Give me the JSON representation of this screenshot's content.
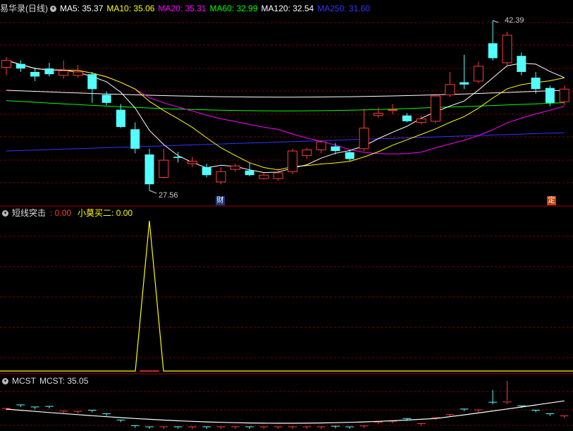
{
  "main_panel": {
    "title": "易华录(日线)",
    "ma": [
      {
        "label": "MA5: 35.37",
        "color": "#ffffff"
      },
      {
        "label": "MA10: 35.06",
        "color": "#ffff00"
      },
      {
        "label": "MA20: 35.31",
        "color": "#ff00ff"
      },
      {
        "label": "MA60: 32.99",
        "color": "#00ff00"
      },
      {
        "label": "MA120: 32.54",
        "color": "#ffffff"
      },
      {
        "label": "MA250: 31.60",
        "color": "#3333ff"
      }
    ],
    "high_label": "42.39",
    "low_label": "27.56",
    "tag_cai": "财",
    "tag_ding": "定"
  },
  "indicator_panel": {
    "name": "短线突击",
    "value1": ": 0.00",
    "name2": "小莫买二",
    "value2": ": 0.00"
  },
  "mcst_panel": {
    "name": "MCST",
    "value": "MCST: 35.05"
  },
  "colors": {
    "up": "#ff3b3b",
    "down": "#54ffff",
    "grid": "#7a0000",
    "divider": "#a00000"
  },
  "chart_data": {
    "type": "candlestick",
    "candles": [
      {
        "o": 38.3,
        "c": 38.9,
        "h": 39.2,
        "l": 37.6
      },
      {
        "o": 38.6,
        "c": 38.2,
        "h": 38.9,
        "l": 37.9
      },
      {
        "o": 37.9,
        "c": 37.5,
        "h": 38.3,
        "l": 37.1
      },
      {
        "o": 38.2,
        "c": 37.7,
        "h": 38.7,
        "l": 37.5
      },
      {
        "o": 37.6,
        "c": 38.0,
        "h": 38.9,
        "l": 37.3
      },
      {
        "o": 37.6,
        "c": 37.9,
        "h": 38.5,
        "l": 37.4
      },
      {
        "o": 37.7,
        "c": 36.4,
        "h": 37.9,
        "l": 35.2
      },
      {
        "o": 35.9,
        "c": 35.2,
        "h": 36.2,
        "l": 35.0
      },
      {
        "o": 34.6,
        "c": 33.1,
        "h": 35.1,
        "l": 33.0
      },
      {
        "o": 32.9,
        "c": 31.2,
        "h": 33.5,
        "l": 30.8
      },
      {
        "o": 30.7,
        "c": 28.1,
        "h": 31.2,
        "l": 27.56
      },
      {
        "o": 28.7,
        "c": 30.2,
        "h": 31.2,
        "l": 28.6
      },
      {
        "o": 30.5,
        "c": 30.4,
        "h": 30.9,
        "l": 30.0
      },
      {
        "o": 29.9,
        "c": 30.1,
        "h": 30.5,
        "l": 29.6
      },
      {
        "o": 29.6,
        "c": 28.9,
        "h": 29.9,
        "l": 28.7
      },
      {
        "o": 28.3,
        "c": 29.2,
        "h": 29.6,
        "l": 28.1
      },
      {
        "o": 29.4,
        "c": 29.7,
        "h": 29.9,
        "l": 29.2
      },
      {
        "o": 29.3,
        "c": 28.9,
        "h": 30.0,
        "l": 28.8
      },
      {
        "o": 28.6,
        "c": 28.9,
        "h": 29.1,
        "l": 28.5
      },
      {
        "o": 28.6,
        "c": 29.1,
        "h": 29.5,
        "l": 28.4
      },
      {
        "o": 29.2,
        "c": 31.0,
        "h": 31.2,
        "l": 29.0
      },
      {
        "o": 30.6,
        "c": 31.1,
        "h": 31.3,
        "l": 30.3
      },
      {
        "o": 31.1,
        "c": 31.8,
        "h": 31.9,
        "l": 30.8
      },
      {
        "o": 31.4,
        "c": 31.0,
        "h": 31.7,
        "l": 30.7
      },
      {
        "o": 30.9,
        "c": 30.3,
        "h": 31.1,
        "l": 30.1
      },
      {
        "o": 31.2,
        "c": 33.0,
        "h": 34.7,
        "l": 31.0
      },
      {
        "o": 34.1,
        "c": 34.3,
        "h": 34.8,
        "l": 33.9
      },
      {
        "o": 34.6,
        "c": 34.6,
        "h": 35.1,
        "l": 34.2
      },
      {
        "o": 34.1,
        "c": 33.6,
        "h": 34.3,
        "l": 33.5
      },
      {
        "o": 33.5,
        "c": 33.8,
        "h": 34.1,
        "l": 33.3
      },
      {
        "o": 33.6,
        "c": 35.8,
        "h": 36.0,
        "l": 33.4
      },
      {
        "o": 35.9,
        "c": 36.8,
        "h": 37.9,
        "l": 35.7
      },
      {
        "o": 37.0,
        "c": 36.8,
        "h": 39.4,
        "l": 36.4
      },
      {
        "o": 37.1,
        "c": 38.4,
        "h": 38.8,
        "l": 36.9
      },
      {
        "o": 40.4,
        "c": 39.1,
        "h": 42.39,
        "l": 38.9
      },
      {
        "o": 38.7,
        "c": 41.1,
        "h": 41.4,
        "l": 38.3
      },
      {
        "o": 39.3,
        "c": 37.9,
        "h": 39.6,
        "l": 37.6
      },
      {
        "o": 37.4,
        "c": 36.4,
        "h": 37.9,
        "l": 36.0
      },
      {
        "o": 36.5,
        "c": 35.2,
        "h": 36.7,
        "l": 34.9
      },
      {
        "o": 35.3,
        "c": 36.4,
        "h": 36.7,
        "l": 35.0
      }
    ],
    "signal": [
      0,
      0,
      0,
      0,
      0,
      0,
      0,
      0,
      0,
      0,
      1,
      0,
      0,
      0,
      0,
      0,
      0,
      0,
      0,
      0,
      0,
      0,
      0,
      0,
      0,
      0,
      0,
      0,
      0,
      0,
      0,
      0,
      0,
      0,
      0,
      0,
      0,
      0,
      0,
      0
    ]
  }
}
